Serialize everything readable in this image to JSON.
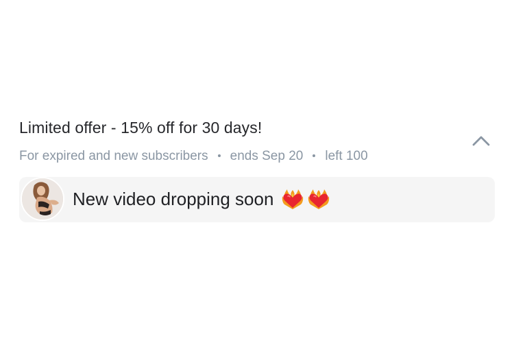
{
  "offer": {
    "title": "Limited offer - 15% off for 30 days!",
    "audience": "For expired and new subscribers",
    "ends": "ends Sep 20",
    "left": "left 100"
  },
  "collapse": {
    "icon": "chevron-up-icon",
    "color": "#8a96a3"
  },
  "message": {
    "text": "New video dropping soon",
    "emojis": [
      "heart-on-fire-emoji",
      "heart-on-fire-emoji"
    ],
    "background": "#f5f5f5"
  },
  "colors": {
    "title": "#26272b",
    "meta": "#8a96a3"
  }
}
